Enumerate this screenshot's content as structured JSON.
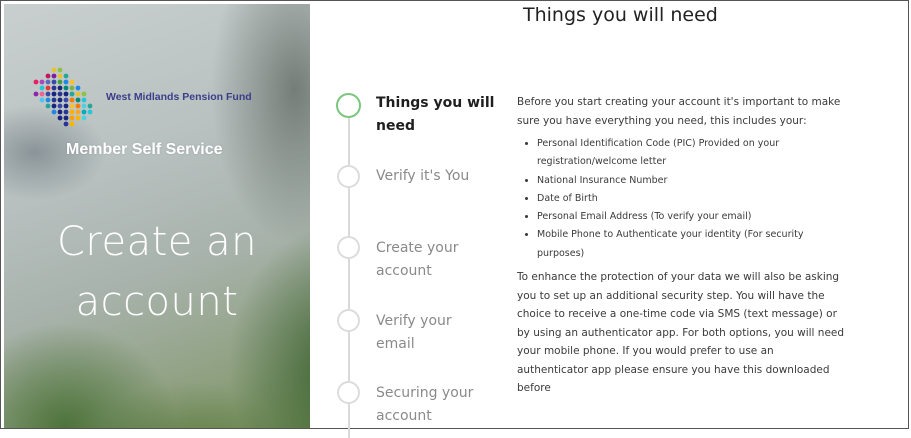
{
  "hero": {
    "org_name": "West Midlands Pension Fund",
    "subtitle": "Member Self Service",
    "title_line1": "Create an",
    "title_line2": "account"
  },
  "page": {
    "title": "Things you will need"
  },
  "steps": [
    {
      "line1": "Things you will",
      "line2": "need",
      "state": "active"
    },
    {
      "line1": "Verify it's You",
      "line2": "",
      "state": "pending"
    },
    {
      "line1": "Create your",
      "line2": "account",
      "state": "pending"
    },
    {
      "line1": "Verify your",
      "line2": "email",
      "state": "pending"
    },
    {
      "line1": "Securing your",
      "line2": "account",
      "state": "pending"
    }
  ],
  "content": {
    "intro": "Before you start creating your account it's important to make sure you have everything you need, this includes your:",
    "items": [
      "Personal Identification Code (PIC) Provided on your registration/welcome letter",
      "National Insurance Number",
      "Date of Birth",
      "Personal Email Address (To verify your email)",
      "Mobile Phone to Authenticate your identity (For security purposes)"
    ],
    "security_note": "To enhance the protection of your data we will also be asking you to set up an additional security step. You will have the choice to receive a one-time code via SMS (text message) or by using an authenticator app. For both options, you will need your mobile phone. If you would prefer to use an authenticator app please ensure you have this downloaded before"
  },
  "colors": {
    "active_step": "#7cc57f",
    "logo_text": "#3b3e8a"
  }
}
